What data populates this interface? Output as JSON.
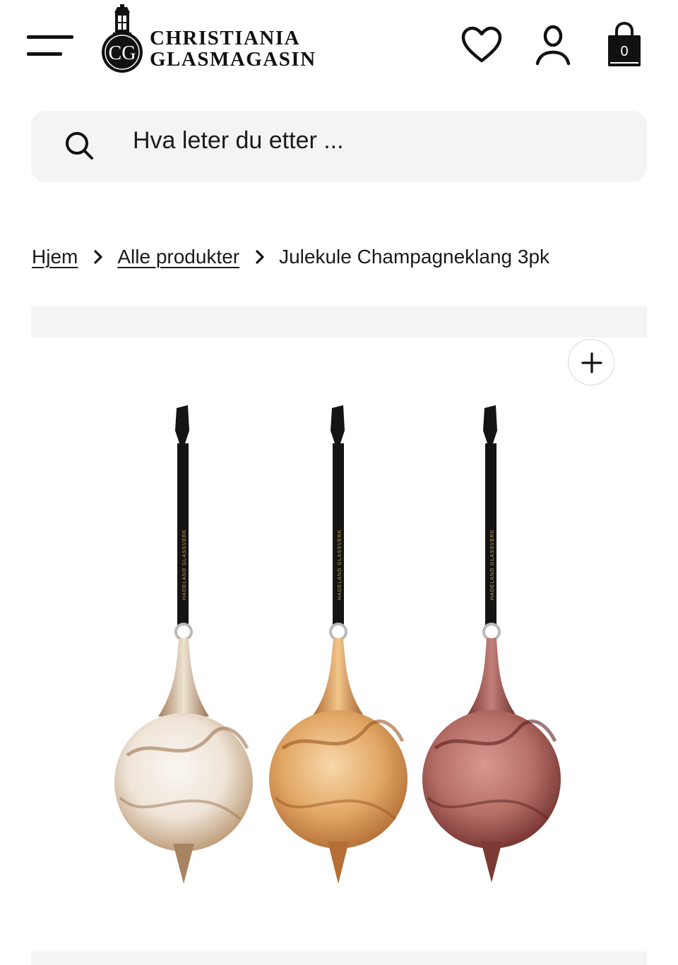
{
  "header": {
    "logo": {
      "monogram": "CG",
      "line1": "CHRISTIANIA",
      "line2": "GLASMAGASIN"
    },
    "cart_count": "0",
    "icons": {
      "menu": "hamburger-menu-icon",
      "wishlist": "heart-icon",
      "account": "user-icon",
      "cart": "shopping-bag-icon"
    }
  },
  "search": {
    "placeholder": "Hva leter du etter ..."
  },
  "breadcrumb": {
    "items": [
      {
        "label": "Hjem"
      },
      {
        "label": "Alle produkter"
      }
    ],
    "current": "Julekule Champagneklang 3pk"
  },
  "product": {
    "zoom_icon": "plus-icon",
    "ornament_ribbon_text": "HADELAND GLASSVERK",
    "ornament_colors": [
      "#e9dccd",
      "#dca56a",
      "#9e5a55"
    ]
  }
}
